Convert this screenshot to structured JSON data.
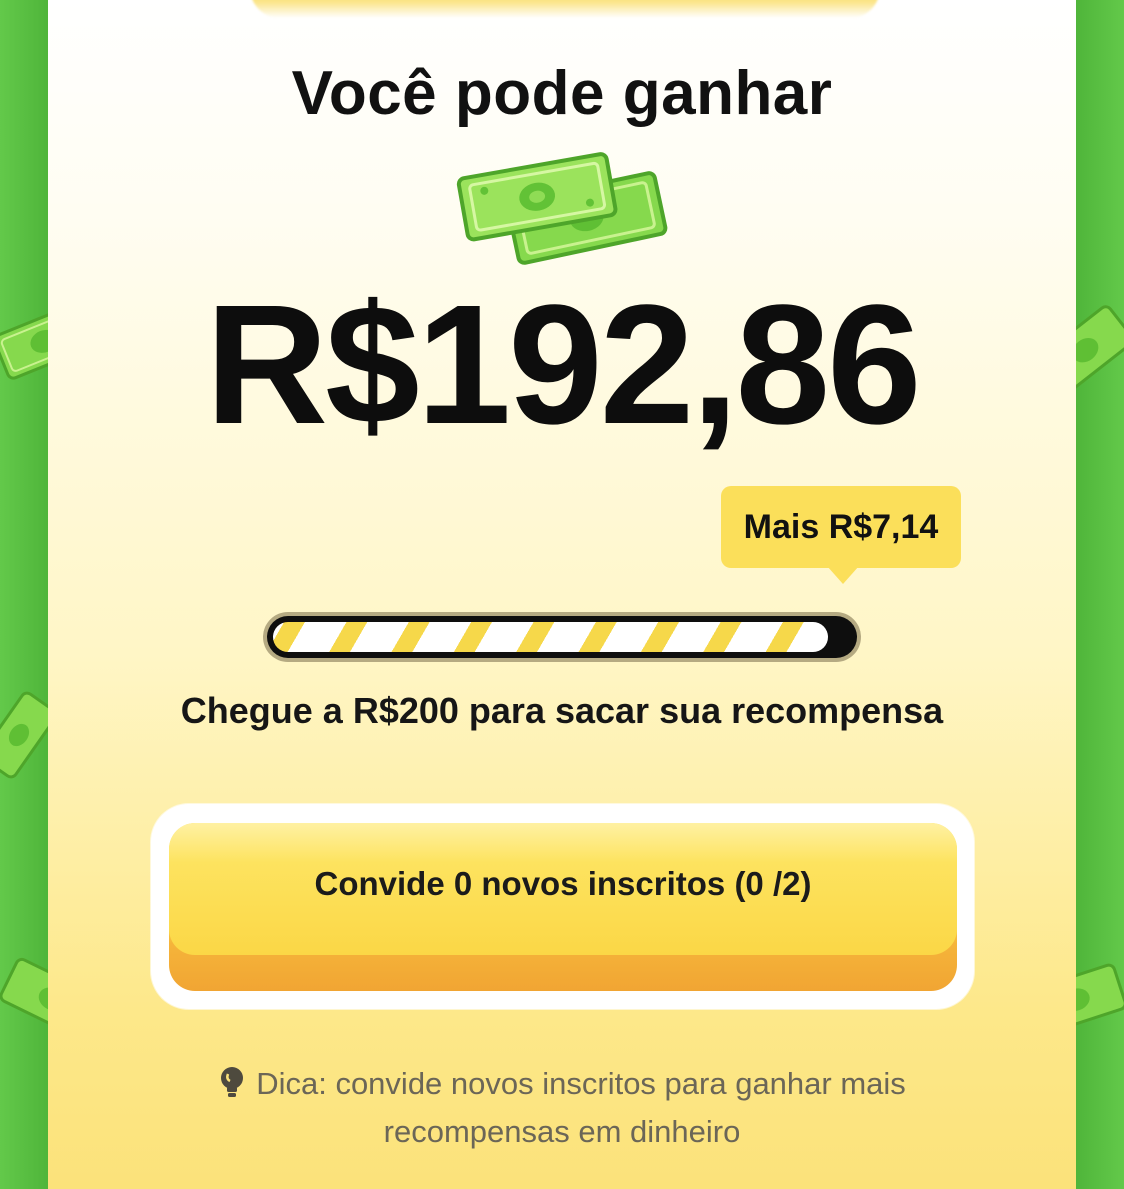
{
  "heading": "Você pode ganhar",
  "amount": "R$192,86",
  "tooltip": "Mais R$7,14",
  "progress": {
    "fraction": 0.96
  },
  "goal_text": "Chegue a R$200 para sacar sua recompensa",
  "invite_button": {
    "label": "Convide 0 novos inscritos (0 /2)"
  },
  "tip": {
    "line1": "Dica: convide novos inscritos para ganhar mais",
    "line2": "recompensas em dinheiro"
  },
  "icons": [
    "money-bills-icon",
    "lightbulb-icon"
  ],
  "colors": {
    "accent_yellow": "#fbdf5a",
    "green": "#5cc043",
    "progress_track": "#0e0e0e"
  }
}
